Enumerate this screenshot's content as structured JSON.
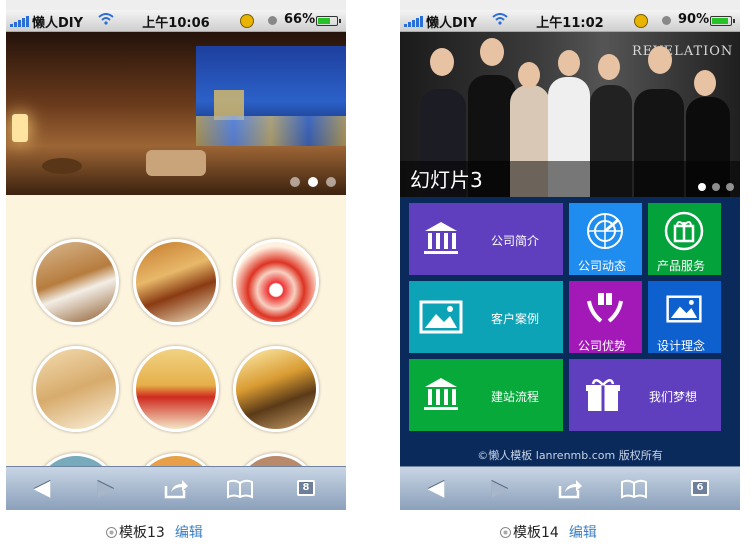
{
  "phone1": {
    "status": {
      "carrier": "懒人DIY",
      "time": "上午10:06",
      "battery": "66%",
      "battery_level": 0.66
    },
    "slider": {
      "dots": 3,
      "active": 1
    },
    "gallery": {
      "items": [
        "room-1",
        "room-2",
        "banquet-hall",
        "bathroom",
        "living-room",
        "lobby"
      ]
    },
    "toolbar": {
      "pages": "8"
    },
    "caption": {
      "label": "模板13",
      "edit": "编辑"
    }
  },
  "phone2": {
    "status": {
      "carrier": "懒人DIY",
      "time": "上午11:02",
      "battery": "90%",
      "battery_level": 0.9
    },
    "slider": {
      "caption": "幻灯片3",
      "dots": 3,
      "active": 0,
      "banner_text": "REVELATION"
    },
    "tiles": [
      {
        "label": "公司简介",
        "icon": "bank-icon",
        "color": "#5f3fbd"
      },
      {
        "label": "公司动态",
        "icon": "radar-icon",
        "color": "#1f8df0"
      },
      {
        "label": "产品服务",
        "icon": "gift-icon",
        "color": "#04a23a"
      },
      {
        "label": "客户案例",
        "icon": "picture-icon",
        "color": "#0ca3b7"
      },
      {
        "label": "公司优势",
        "icon": "hands-gift-icon",
        "color": "#a219b8"
      },
      {
        "label": "设计理念",
        "icon": "picture-icon",
        "color": "#0f60cf"
      },
      {
        "label": "建站流程",
        "icon": "bank-icon",
        "color": "#07a93b"
      },
      {
        "label": "我们梦想",
        "icon": "gift-icon",
        "color": "#5f3fbd"
      }
    ],
    "footer": "©懒人模板 lanrenmb.com 版权所有",
    "toolbar": {
      "pages": "6"
    },
    "caption": {
      "label": "模板14",
      "edit": "编辑"
    }
  }
}
